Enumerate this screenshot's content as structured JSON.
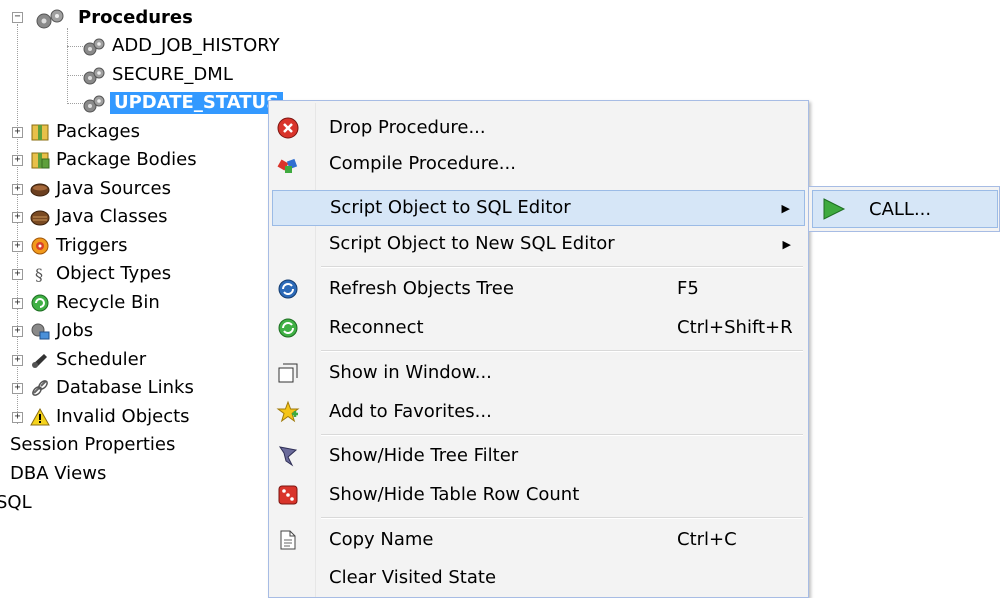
{
  "tree": {
    "procedures_label": "Procedures",
    "procedures": [
      "ADD_JOB_HISTORY",
      "SECURE_DML",
      "UPDATE_STATUS"
    ],
    "items": [
      "Packages",
      "Package Bodies",
      "Java Sources",
      "Java Classes",
      "Triggers",
      "Object Types",
      "Recycle Bin",
      "Jobs",
      "Scheduler",
      "Database Links",
      "Invalid Objects"
    ],
    "roots": [
      "Session Properties",
      "DBA Views",
      "SQL"
    ]
  },
  "menu": {
    "drop": "Drop Procedure...",
    "compile": "Compile Procedure...",
    "script_editor": "Script Object to SQL Editor",
    "script_new_editor": "Script Object to New SQL Editor",
    "refresh": "Refresh Objects Tree",
    "refresh_key": "F5",
    "reconnect": "Reconnect",
    "reconnect_key": "Ctrl+Shift+R",
    "show_window": "Show in Window...",
    "favorites": "Add to Favorites...",
    "tree_filter": "Show/Hide Tree Filter",
    "row_count": "Show/Hide Table Row Count",
    "copy_name": "Copy Name",
    "copy_key": "Ctrl+C",
    "clear_visited": "Clear Visited State"
  },
  "submenu": {
    "call": "CALL..."
  },
  "icons": [
    "gears-icon",
    "package-icon",
    "package-body-icon",
    "java-source-icon",
    "java-class-icon",
    "trigger-icon",
    "object-type-icon",
    "recycle-bin-icon",
    "jobs-icon",
    "scheduler-icon",
    "database-link-icon",
    "warning-icon",
    "drop-icon",
    "compile-icon",
    "refresh-icon",
    "reconnect-icon",
    "window-icon",
    "favorites-star-icon",
    "filter-icon",
    "dice-icon",
    "copy-icon",
    "play-arrow-icon"
  ]
}
